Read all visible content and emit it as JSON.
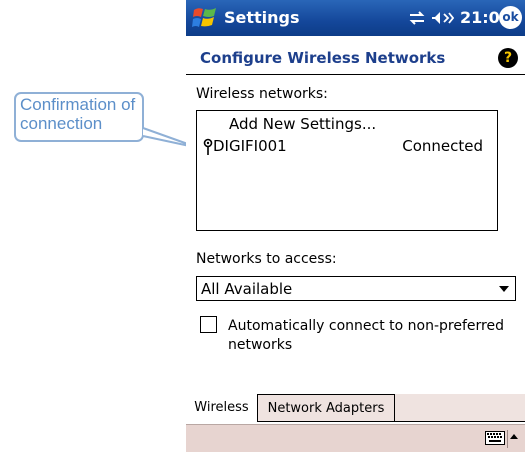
{
  "callout": {
    "text": "Confirmation of connection",
    "color": "#5c8fc9"
  },
  "titlebar": {
    "title": "Settings",
    "time": "21:00",
    "ok_label": "ok",
    "icons": [
      "windows-start-icon",
      "connectivity-icon",
      "speaker-icon"
    ]
  },
  "header": {
    "title": "Configure Wireless Networks",
    "help_label": "?"
  },
  "wireless": {
    "label": "Wireless networks:",
    "items": [
      {
        "name": "Add New Settings...",
        "status": ""
      },
      {
        "name": "DIGIFI001",
        "status": "Connected",
        "icon": "antenna-icon"
      }
    ]
  },
  "access": {
    "label": "Networks to access:",
    "selected": "All Available"
  },
  "auto_connect": {
    "label": "Automatically connect to non-preferred networks",
    "checked": false
  },
  "tabs": [
    {
      "label": "Wireless",
      "active": true
    },
    {
      "label": "Network Adapters",
      "active": false
    }
  ],
  "menubar": {
    "icons": [
      "keyboard-icon",
      "sip-up-arrow-icon"
    ]
  },
  "colors": {
    "titlebar": "#14479a",
    "header_text": "#1d3f8c",
    "menubar": "#e7d4d0"
  }
}
